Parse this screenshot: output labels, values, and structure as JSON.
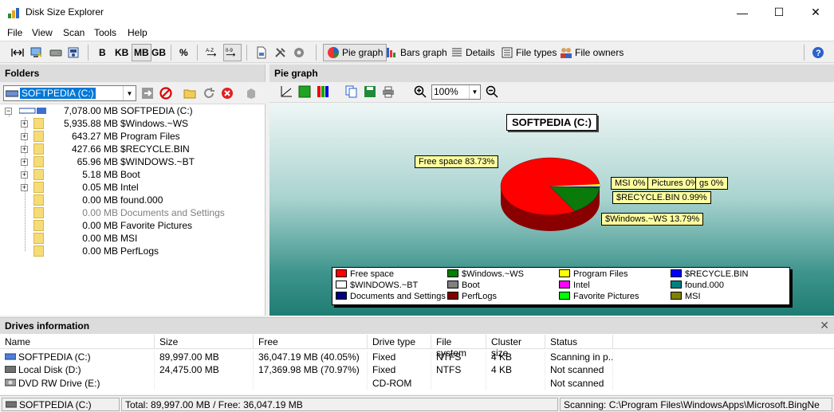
{
  "window": {
    "title": "Disk Size Explorer",
    "min": "—",
    "max": "☐",
    "close": "✕"
  },
  "menu": [
    "File",
    "View",
    "Scan",
    "Tools",
    "Help"
  ],
  "toolbar": {
    "b": "B",
    "kb": "KB",
    "mb": "MB",
    "gb": "GB",
    "pct": "%",
    "pie": "Pie graph",
    "bars": "Bars graph",
    "details": "Details",
    "filetypes": "File types",
    "owners": "File owners"
  },
  "folders": {
    "header": "Folders",
    "drive_select": "SOFTPEDIA (C:)",
    "tree": [
      {
        "size": "7,078.00 MB",
        "name": "SOFTPEDIA (C:)",
        "gray": false
      },
      {
        "size": "5,935.88 MB",
        "name": "$Windows.~WS",
        "gray": false
      },
      {
        "size": "643.27 MB",
        "name": "Program Files",
        "gray": false
      },
      {
        "size": "427.66 MB",
        "name": "$RECYCLE.BIN",
        "gray": false
      },
      {
        "size": "65.96 MB",
        "name": "$WINDOWS.~BT",
        "gray": false
      },
      {
        "size": "5.18 MB",
        "name": "Boot",
        "gray": false
      },
      {
        "size": "0.05 MB",
        "name": "Intel",
        "gray": false
      },
      {
        "size": "0.00 MB",
        "name": "found.000",
        "gray": false
      },
      {
        "size": "0.00 MB",
        "name": "Documents and Settings",
        "gray": true
      },
      {
        "size": "0.00 MB",
        "name": "Favorite Pictures",
        "gray": false
      },
      {
        "size": "0.00 MB",
        "name": "MSI",
        "gray": false
      },
      {
        "size": "0.00 MB",
        "name": "PerfLogs",
        "gray": false
      }
    ]
  },
  "pie": {
    "header": "Pie graph",
    "zoom": "100%",
    "title": "SOFTPEDIA (C:)",
    "callouts": {
      "free": "Free space 83.73%",
      "msi": "MSI 0%",
      "pictures": "Pictures 0%",
      "gs": "gs 0%",
      "recycle": "$RECYCLE.BIN 0.99%",
      "windows": "$Windows.~WS 13.79%"
    },
    "legend": [
      {
        "label": "Free space",
        "color": "#ff0000"
      },
      {
        "label": "$Windows.~WS",
        "color": "#008000"
      },
      {
        "label": "Program Files",
        "color": "#ffff00"
      },
      {
        "label": "$RECYCLE.BIN",
        "color": "#0000ff"
      },
      {
        "label": "$WINDOWS.~BT",
        "color": "#ffffff"
      },
      {
        "label": "Boot",
        "color": "#808080"
      },
      {
        "label": "Intel",
        "color": "#ff00ff"
      },
      {
        "label": "found.000",
        "color": "#008080"
      },
      {
        "label": "Documents and Settings",
        "color": "#000080"
      },
      {
        "label": "PerfLogs",
        "color": "#800000"
      },
      {
        "label": "Favorite Pictures",
        "color": "#00ff00"
      },
      {
        "label": "MSI",
        "color": "#808000"
      }
    ]
  },
  "drives": {
    "header": "Drives information",
    "close": "✕",
    "columns": [
      "Name",
      "Size",
      "Free",
      "Drive type",
      "File system",
      "Cluster size",
      "Status"
    ],
    "rows": [
      [
        "SOFTPEDIA (C:)",
        "89,997.00 MB",
        "36,047.19 MB (40.05%)",
        "Fixed",
        "NTFS",
        "4 KB",
        "Scanning in p..."
      ],
      [
        "Local Disk (D:)",
        "24,475.00 MB",
        "17,369.98 MB (70.97%)",
        "Fixed",
        "NTFS",
        "4 KB",
        "Not scanned"
      ],
      [
        "DVD RW Drive (E:)",
        "",
        "",
        "CD-ROM",
        "",
        "",
        "Not scanned"
      ]
    ]
  },
  "status": {
    "drive": "SOFTPEDIA (C:)",
    "total": "Total: 89,997.00 MB / Free: 36,047.19 MB",
    "scanning": "Scanning: C:\\Program Files\\WindowsApps\\Microsoft.BingNe"
  }
}
